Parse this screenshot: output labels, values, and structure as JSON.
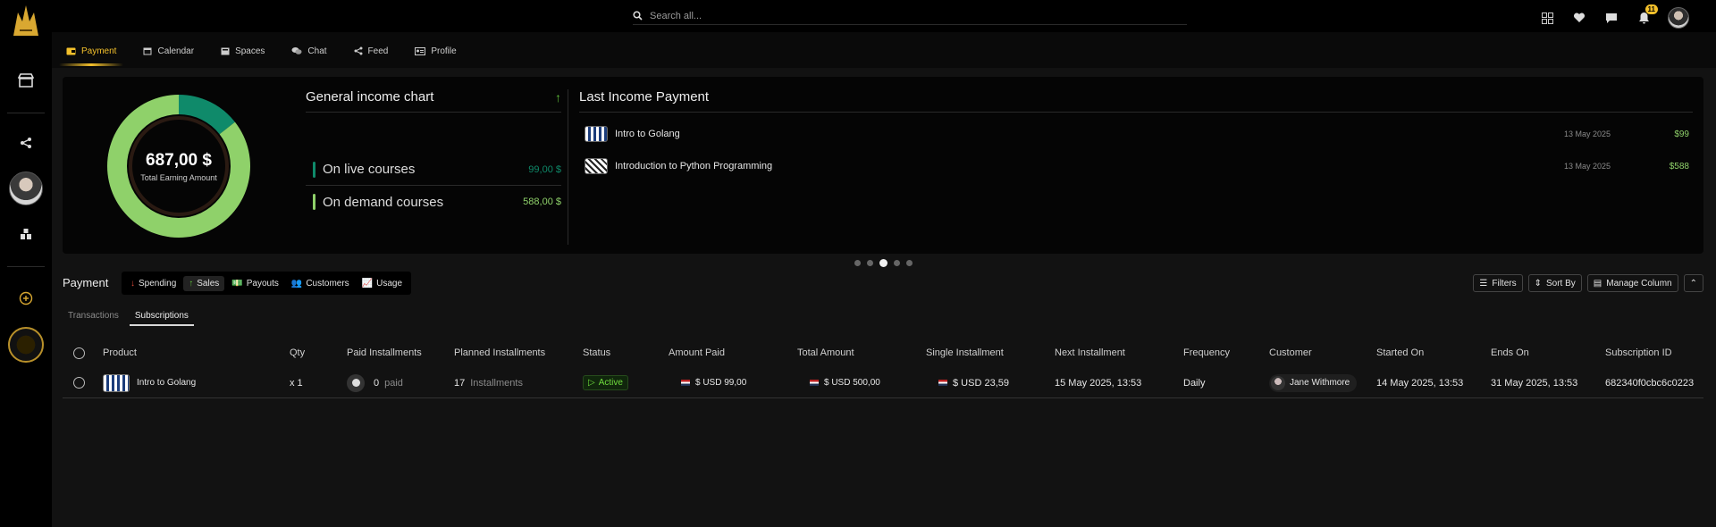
{
  "app": {
    "search_placeholder": "Search all...",
    "notification_count": "11"
  },
  "tabs": [
    {
      "label": "Payment",
      "icon": "wallet-icon",
      "active": true
    },
    {
      "label": "Calendar",
      "icon": "calendar-icon"
    },
    {
      "label": "Spaces",
      "icon": "spaces-icon"
    },
    {
      "label": "Chat",
      "icon": "chat-icon"
    },
    {
      "label": "Feed",
      "icon": "share-icon"
    },
    {
      "label": "Profile",
      "icon": "profile-card-icon"
    }
  ],
  "income_summary": {
    "total_amount": "687,00 $",
    "total_label": "Total Earning Amount",
    "chart_title": "General income chart",
    "rows": [
      {
        "label": "On live courses",
        "value": "99,00 $",
        "color": "#0f8a6a"
      },
      {
        "label": "On demand courses",
        "value": "588,00 $",
        "color": "#8fd16a"
      }
    ]
  },
  "chart_data": {
    "type": "pie",
    "title": "",
    "categories": [
      "On live courses",
      "On demand courses"
    ],
    "values": [
      99,
      588
    ],
    "colors": [
      "#0f8a6a",
      "#8fd16a"
    ],
    "donut": true
  },
  "last_income": {
    "title": "Last Income Payment",
    "items": [
      {
        "name": "Intro to Golang",
        "date": "13 May 2025",
        "amount": "$99"
      },
      {
        "name": "Introduction to Python Programming",
        "date": "13 May 2025",
        "amount": "$588"
      }
    ]
  },
  "carousel": {
    "count": 5,
    "active_index": 2
  },
  "payment": {
    "title": "Payment",
    "segments": [
      {
        "label": "Spending",
        "icon": "arrow-down-icon"
      },
      {
        "label": "Sales",
        "icon": "arrow-up-icon",
        "active": true
      },
      {
        "label": "Payouts",
        "icon": "cash-icon"
      },
      {
        "label": "Customers",
        "icon": "users-icon"
      },
      {
        "label": "Usage",
        "icon": "trend-icon"
      }
    ],
    "tools": {
      "filters": "Filters",
      "sort": "Sort By",
      "columns": "Manage Column"
    },
    "subtabs": [
      {
        "label": "Transactions"
      },
      {
        "label": "Subscriptions",
        "active": true
      }
    ]
  },
  "table": {
    "headers": {
      "product": "Product",
      "qty": "Qty",
      "paid_installments": "Paid Installments",
      "planned_installments": "Planned Installments",
      "status": "Status",
      "amount_paid": "Amount Paid",
      "total_amount": "Total Amount",
      "single_installment": "Single Installment",
      "next_installment": "Next Installment",
      "frequency": "Frequency",
      "customer": "Customer",
      "started_on": "Started On",
      "ends_on": "Ends On",
      "subscription_id": "Subscription ID"
    },
    "rows": [
      {
        "product": "Intro to Golang",
        "qty": "x 1",
        "paid_count": "0",
        "paid_label": "paid",
        "planned_count": "17",
        "planned_label": "Installments",
        "status": "Active",
        "amount_paid": "$ USD 99,00",
        "total_amount": "$ USD 500,00",
        "single_installment": "$ USD 23,59",
        "next_installment": "15 May 2025, 13:53",
        "frequency": "Daily",
        "customer": "Jane Withmore",
        "started_on": "14 May 2025, 13:53",
        "ends_on": "31 May 2025, 13:53",
        "subscription_id": "682340f0cbc6c0223"
      }
    ]
  },
  "colors": {
    "accent": "#f3c02b",
    "positive": "#8fd16a",
    "teal": "#0f8a6a"
  }
}
